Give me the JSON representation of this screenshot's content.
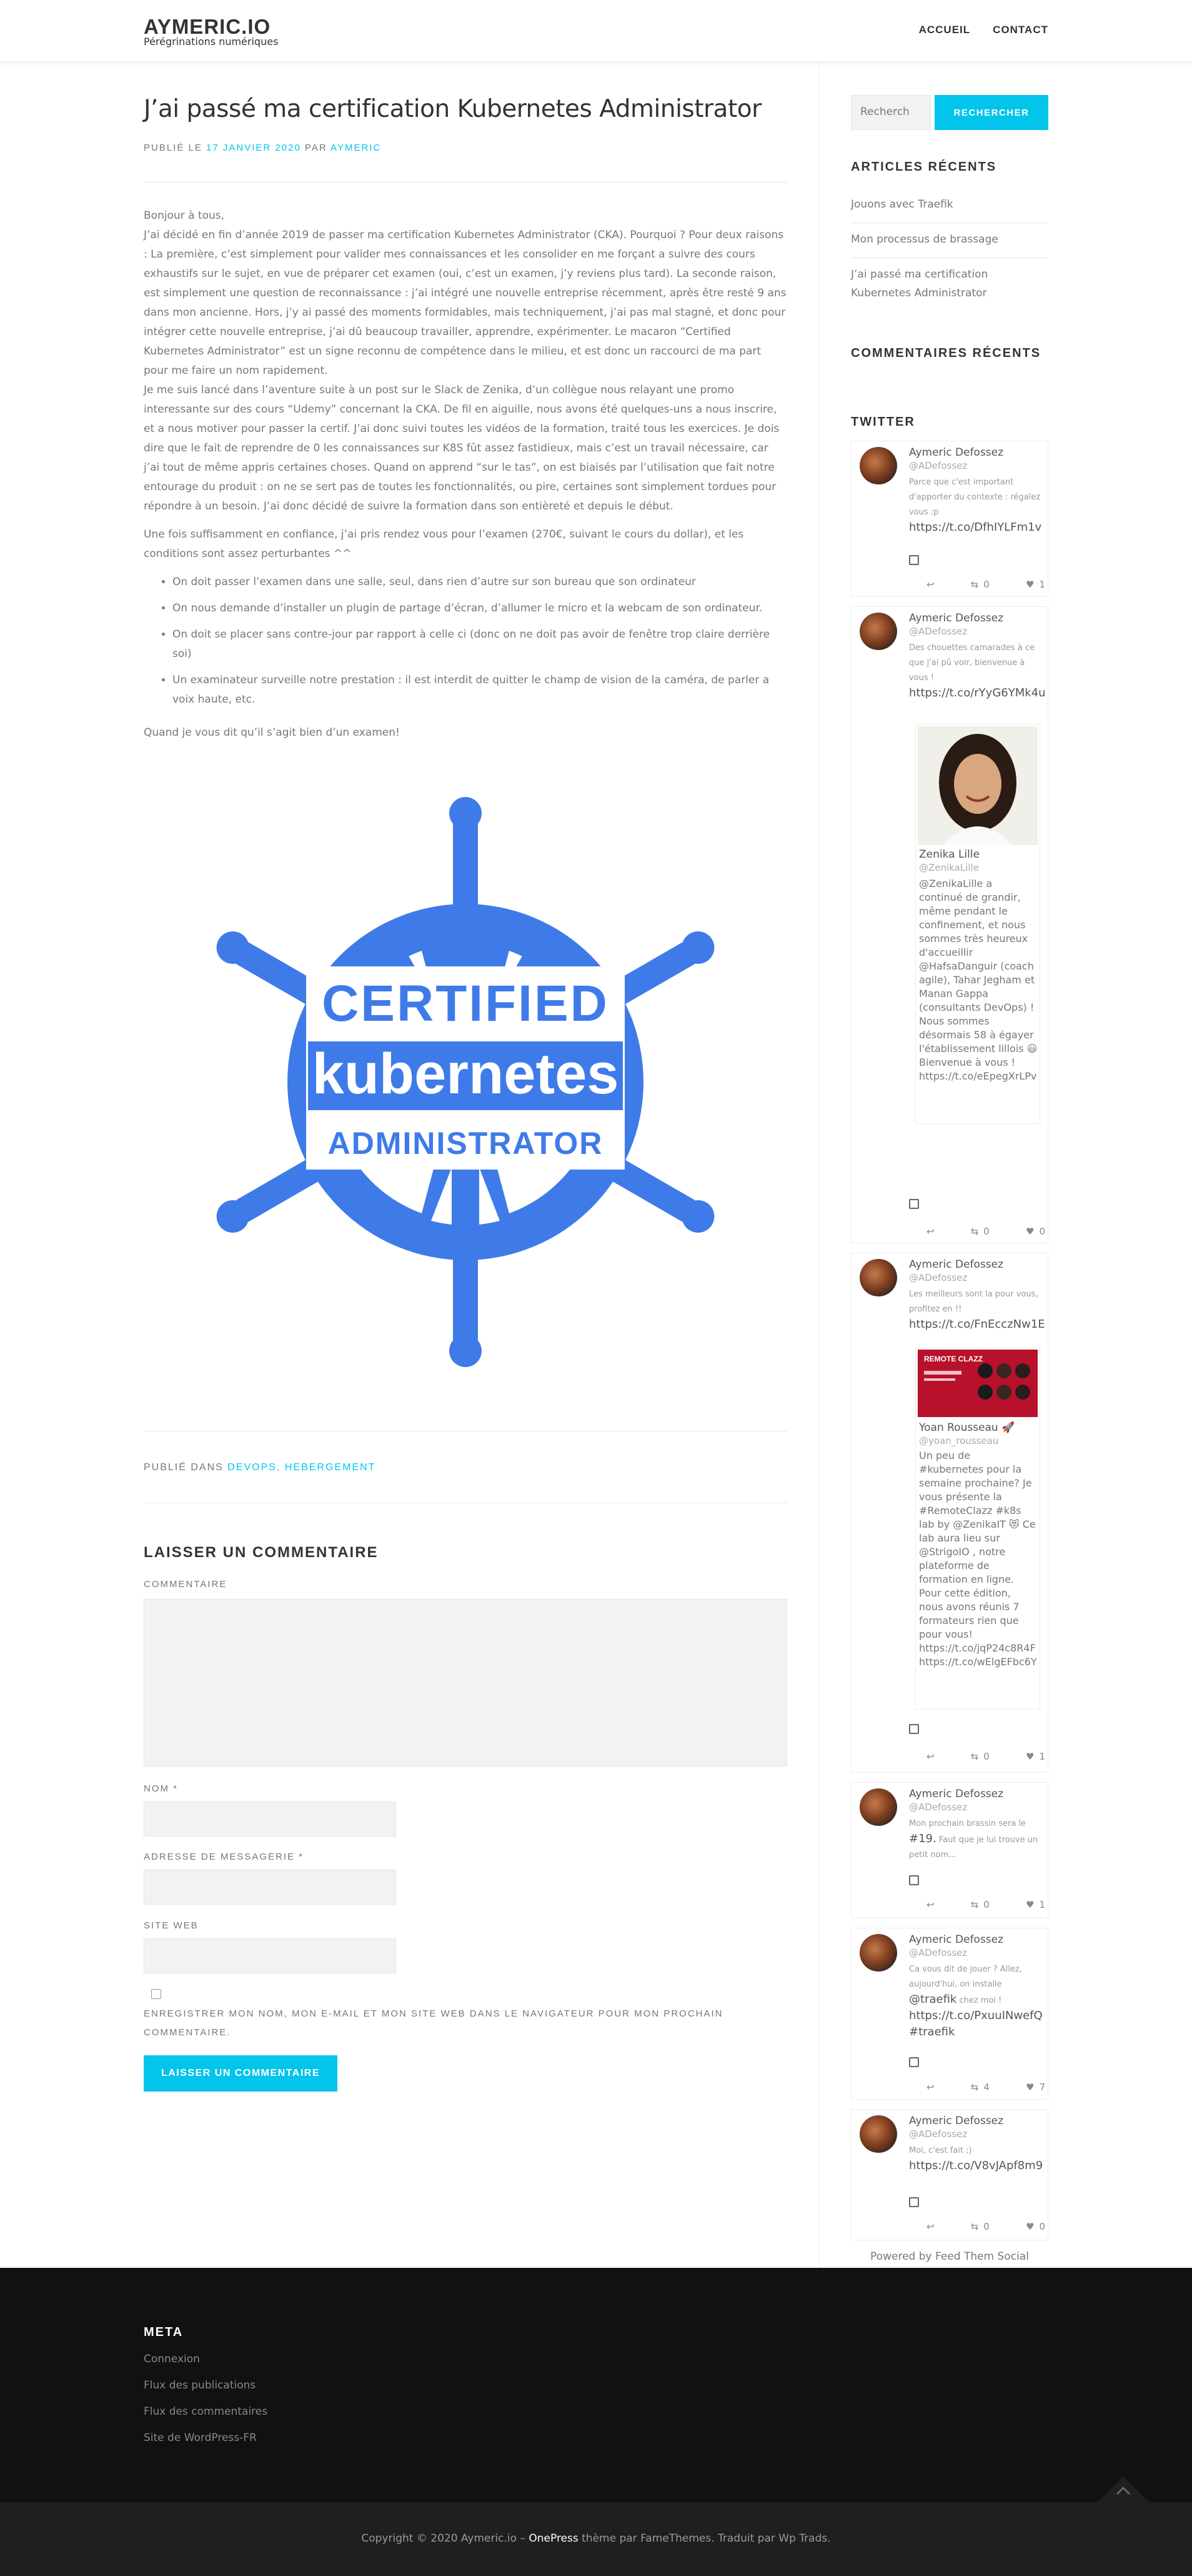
{
  "header": {
    "site_title": "AYMERIC.IO",
    "tagline": "Pérégrinations numériques",
    "nav": [
      "ACCUEIL",
      "CONTACT"
    ]
  },
  "post": {
    "title": "J’ai passé ma certification Kubernetes Administrator",
    "meta_prefix": "PUBLIÉ LE",
    "meta_date": "17 JANVIER 2020",
    "meta_by": "PAR",
    "meta_author": "AYMERIC",
    "paragraphs": [
      "Bonjour à tous,",
      "J’ai décidé en fin d’année 2019 de passer ma certification Kubernetes Administrator (CKA). Pourquoi ? Pour deux raisons : La première, c’est simplement pour valider mes connaissances et les consolider en me forçant a suivre des cours exhaustifs sur le sujet, en vue de préparer cet examen (oui, c’est un examen, j’y reviens plus tard). La seconde raison, est simplement une question de reconnaissance : j’ai intégré une nouvelle entreprise récemment, après être resté 9 ans dans mon ancienne. Hors, j’y ai passé des moments formidables, mais techniquement, j’ai pas mal stagné, et donc pour intégrer cette nouvelle entreprise, j’ai dû beaucoup travailler, apprendre, expérimenter. Le macaron “Certified Kubernetes Administrator” est un signe reconnu de compétence dans le milieu, et est donc un raccourci de ma part pour me faire un nom rapidement.",
      "Je me suis lancé dans l’aventure suite à un post sur le Slack de Zenika, d’un collègue nous relayant une promo interessante sur des cours “Udemy” concernant la CKA. De fil en aiguille, nous avons été quelques-uns a nous inscrire, et a nous motiver pour passer la certif. J’ai donc suivi toutes les vidéos de la formation, traité tous les exercices. Je dois dire que le fait de reprendre de 0 les connaissances sur K8S fût assez fastidieux, mais c’est un travail nécessaire, car j’ai tout de même appris certaines choses. Quand on apprend “sur le tas”, on est biaisés par l’utilisation que fait notre entourage du produit : on ne se sert pas de toutes les fonctionnalités, ou pire, certaines sont simplement tordues pour répondre à un besoin. J’ai donc décidé de suivre la formation dans son entièreté et depuis le début.",
      "Une fois suffisamment en confiance, j’ai pris rendez vous pour l’examen (270€, suivant le cours du dollar), et les conditions sont assez perturbantes ^^"
    ],
    "bullets": [
      "On doit passer l’examen dans une salle, seul, dans rien d’autre sur son bureau que son ordinateur",
      "On nous demande d’installer un plugin de partage d’écran, d’allumer le micro et la webcam de son ordinateur.",
      "On doit se placer sans contre-jour par rapport à celle ci (donc on ne doit pas avoir de fenêtre trop claire derrière soi)",
      "Un examinateur surveille notre prestation : il est interdit de quitter le champ de vision de la caméra, de parler a voix haute, etc."
    ],
    "closing": "Quand je vous dit qu’il s’agit bien d’un examen!",
    "badge": {
      "line1": "CERTIFIED",
      "line2": "kubernetes",
      "line3": "ADMINISTRATOR",
      "color": "#3f7be8"
    },
    "footer_prefix": "PUBLIÉ DANS",
    "footer_categories": "DEVOPS, HEBERGEMENT"
  },
  "comment_form": {
    "title": "LAISSER UN COMMENTAIRE",
    "comment_label": "COMMENTAIRE",
    "name_label": "NOM *",
    "email_label": "ADRESSE DE MESSAGERIE *",
    "website_label": "SITE WEB",
    "consent": "ENREGISTRER MON NOM, MON E-MAIL ET MON SITE WEB DANS LE NAVIGATEUR POUR MON PROCHAIN COMMENTAIRE.",
    "submit": "LAISSER UN COMMENTAIRE"
  },
  "sidebar": {
    "search_placeholder": "Recherch",
    "search_button": "RECHERCHER",
    "recent_title": "ARTICLES RÉCENTS",
    "recent_posts": [
      "Jouons avec Traefik",
      "Mon processus de brassage",
      "J’ai passé ma certification Kubernetes Administrator"
    ],
    "comments_title": "COMMENTAIRES RÉCENTS",
    "twitter_title": "TWITTER",
    "tweets": [
      {
        "name": "Aymeric Defossez",
        "handle": "@ADefossez",
        "text_small": "Parce que c'est important d'apporter du contexte : régalez vous :p",
        "text_link": "https://t.co/DfhIYLFm1v",
        "retweets": "0",
        "likes": "1"
      },
      {
        "name": "Aymeric Defossez",
        "handle": "@ADefossez",
        "text_small": "Des chouettes camarades à ce que j'ai pû voir, bienvenue à vous !",
        "text_link": "https://t.co/rYyG6YMk4u",
        "quote_name": "Zenika Lille",
        "quote_handle": "@ZenikaLille",
        "quote_text": "@ZenikaLille a continué de grandir, même pendant le confinement, et nous sommes très heureux d'accueillir @HafsaDanguir (coach agile), Tahar Jegham et Manan Gappa (consultants DevOps) ! Nous sommes désormais 58 à égayer l'établissement lillois 😃 Bienvenue à vous ! https://t.co/eEpegXrLPv",
        "retweets": "0",
        "likes": "0"
      },
      {
        "name": "Aymeric Defossez",
        "handle": "@ADefossez",
        "text_small": "Les meilleurs sont la pour vous, profitez en !!",
        "text_link": "https://t.co/FnEcczNw1E",
        "media_title": "REMOTE CLAZZ",
        "quote_name": "Yoan Rousseau 🚀",
        "quote_handle": "@yoan_rousseau",
        "quote_text": "Un peu de #kubernetes pour la semaine prochaine? Je vous présente la #RemoteClazz #k8s lab by @ZenikaIT 😻 Ce lab aura lieu sur @StrigoIO , notre plateforme de formation en ligne. Pour cette édition, nous avons réunis 7 formateurs rien que pour vous! https://t.co/jqP24c8R4F https://t.co/wElgEFbc6Y",
        "retweets": "0",
        "likes": "1"
      },
      {
        "name": "Aymeric Defossez",
        "handle": "@ADefossez",
        "text_small": "Mon prochain brassin sera le",
        "text_link": "#19.",
        "text_small2": "Faut que je lui trouve un petit nom...",
        "retweets": "0",
        "likes": "1"
      },
      {
        "name": "Aymeric Defossez",
        "handle": "@ADefossez",
        "text_small": "Ca vous dit de jouer ? Allez, aujourd'hui, on installe",
        "text_link": "@traefik",
        "text_small2": "chez moi !",
        "text_link2": "https://t.co/PxuuINwefQ #traefik",
        "retweets": "4",
        "likes": "7"
      },
      {
        "name": "Aymeric Defossez",
        "handle": "@ADefossez",
        "text_small": "Moi, c'est fait ;)",
        "text_link": "https://t.co/V8vJApf8m9",
        "retweets": "0",
        "likes": "0"
      }
    ],
    "powered": "Powered by Feed Them Social"
  },
  "footer": {
    "meta_title": "META",
    "links": [
      "Connexion",
      "Flux des publications",
      "Flux des commentaires",
      "Site de WordPress-FR"
    ],
    "copyright_before": "Copyright © 2020 Aymeric.io –",
    "copyright_theme": "OnePress",
    "copyright_after": "thème par FameThemes. Traduit par Wp Trads."
  },
  "colors": {
    "accent": "#03c4eb",
    "badge_blue": "#3f7be8",
    "footer_bg": "#111111",
    "copyright_bg": "#1f1f1f"
  }
}
